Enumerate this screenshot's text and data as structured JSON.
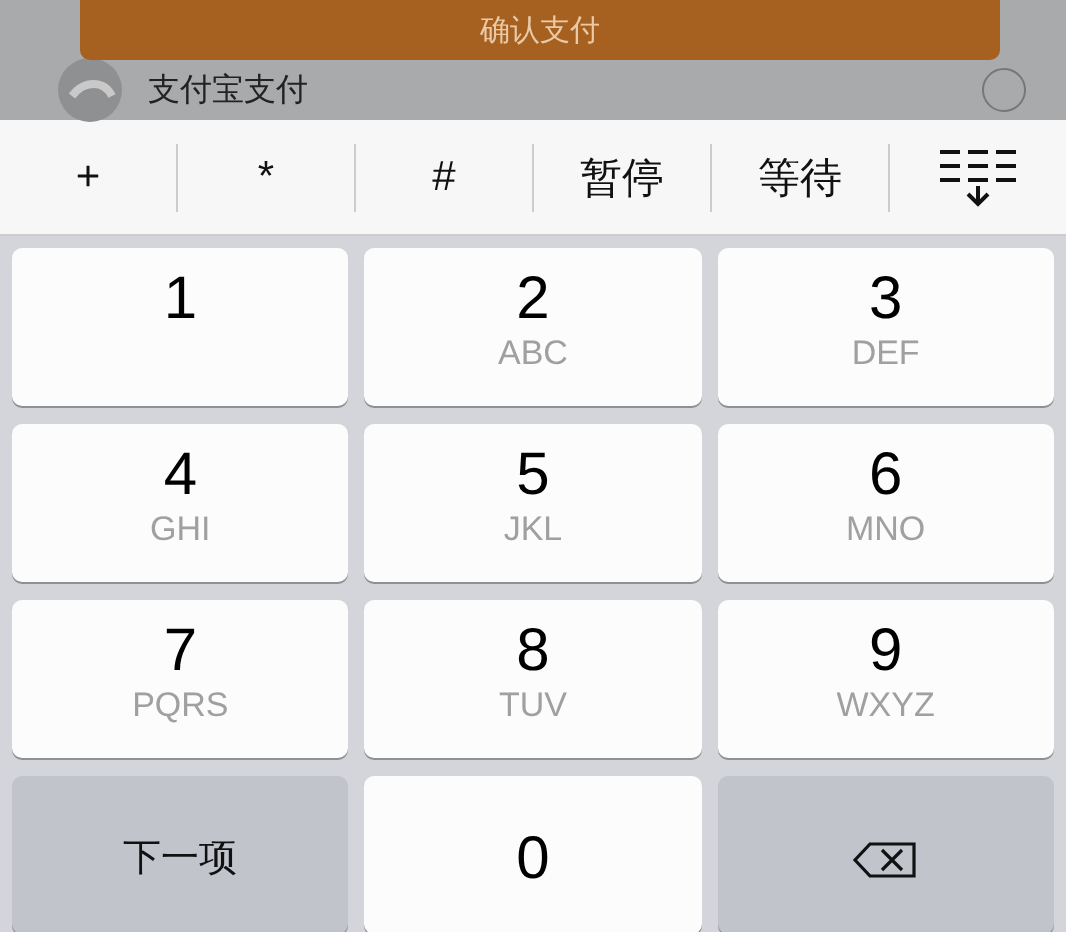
{
  "dialog": {
    "confirm_button": "确认支付",
    "payment_option": {
      "label": "支付宝支付",
      "selected": false
    }
  },
  "toolbar": {
    "keys": [
      "+",
      "*",
      "#",
      "暂停",
      "等待"
    ]
  },
  "keypad": {
    "keys": [
      {
        "kind": "digit",
        "digit": "1"
      },
      {
        "kind": "digit",
        "digit": "2",
        "letters": "ABC"
      },
      {
        "kind": "digit",
        "digit": "3",
        "letters": "DEF"
      },
      {
        "kind": "digit",
        "digit": "4",
        "letters": "GHI"
      },
      {
        "kind": "digit",
        "digit": "5",
        "letters": "JKL"
      },
      {
        "kind": "digit",
        "digit": "6",
        "letters": "MNO"
      },
      {
        "kind": "digit",
        "digit": "7",
        "letters": "PQRS"
      },
      {
        "kind": "digit",
        "digit": "8",
        "letters": "TUV"
      },
      {
        "kind": "digit",
        "digit": "9",
        "letters": "WXYZ"
      },
      {
        "kind": "action",
        "label": "下一项"
      },
      {
        "kind": "digit",
        "digit": "0"
      },
      {
        "kind": "backspace"
      }
    ]
  }
}
